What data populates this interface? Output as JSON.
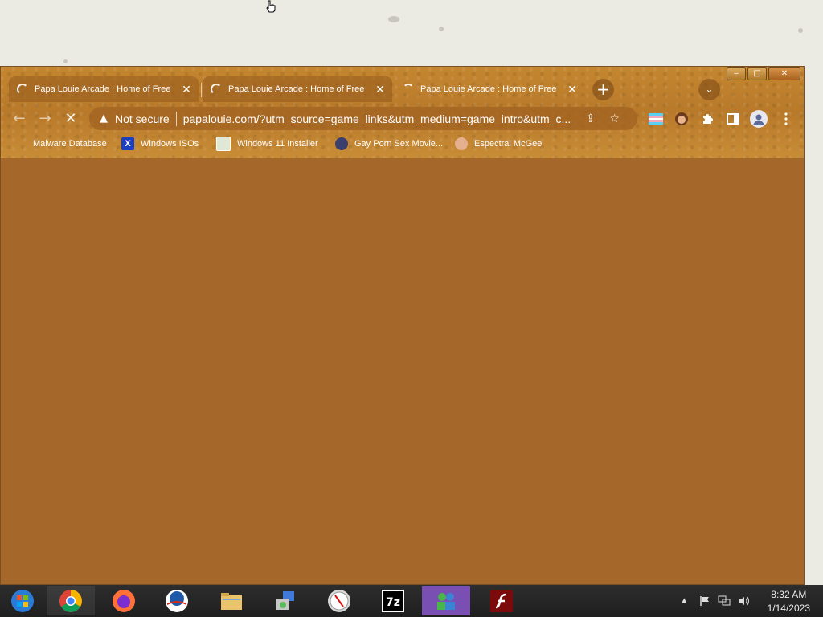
{
  "window": {
    "controls": {
      "minimize": "‒",
      "maximize": "□",
      "close": "✕"
    }
  },
  "tabs": [
    {
      "title": "Papa Louie Arcade : Home of Free",
      "close": "✕",
      "icon": "loading-spinner-icon"
    },
    {
      "title": "Papa Louie Arcade : Home of Free",
      "close": "✕",
      "icon": "loading-spinner-icon"
    },
    {
      "title": "Papa Louie Arcade : Home of Free",
      "close": "✕",
      "icon": "loading-spinner-icon"
    }
  ],
  "new_tab_label": "+",
  "tab_search_label": "⌄",
  "toolbar": {
    "back": "←",
    "forward": "→",
    "stop": "✕",
    "security_icon": "▲",
    "security_text": "Not secure",
    "url": "papalouie.com/?utm_source=game_links&utm_medium=game_intro&utm_c...",
    "share": "⇪",
    "star": "☆"
  },
  "bookmarks": [
    {
      "label": "Malware Database",
      "icon": "malware-database-icon"
    },
    {
      "label": "Windows ISOs",
      "icon": "windows-isos-icon"
    },
    {
      "label": "Windows 11 Installer",
      "icon": "windows-installer-icon"
    },
    {
      "label": "Gay Porn Sex Movie...",
      "icon": "bookmark-favicon-icon"
    },
    {
      "label": "Espectral McGee",
      "icon": "espectral-mcgee-icon"
    }
  ],
  "taskbar": {
    "apps": [
      "start-orb-icon",
      "chrome-icon",
      "firefox-icon",
      "obama-logo-icon",
      "file-explorer-icon",
      "installer-icon",
      "compass-icon",
      "7zip-icon",
      "messenger-icon",
      "flash-icon"
    ],
    "tray_arrow": "▴",
    "clock_time": "8:32 AM",
    "clock_date": "1/14/2023"
  },
  "colors": {
    "content_bg": "#a5672a",
    "frame": "#c4862f",
    "taskbar": "#262626"
  }
}
